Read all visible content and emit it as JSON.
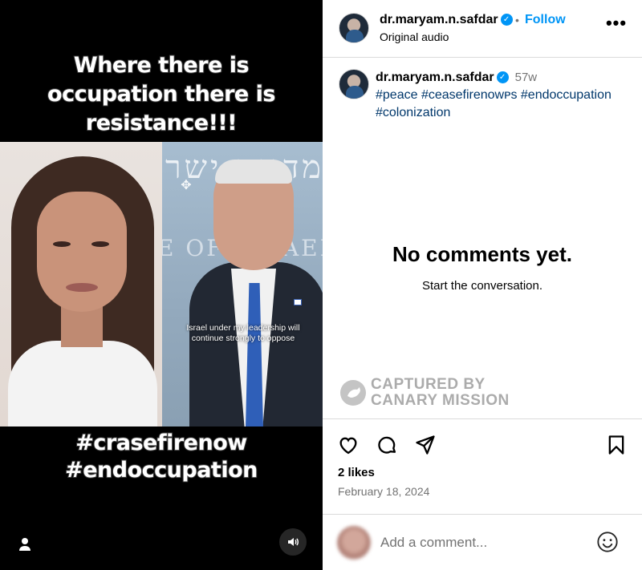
{
  "media": {
    "caption_top": [
      "Where there is",
      "occupation there is",
      "resistance!!!"
    ],
    "caption_bottom": [
      "#crasefirenow",
      "#endoccupation"
    ],
    "video_subtitle": "Israel under my leadership will continue strongly to oppose",
    "background_text_line1": "מדינת ישר",
    "background_text_line2": "E OF ISRAEL"
  },
  "header": {
    "username": "dr.maryam.n.safdar",
    "separator": "•",
    "follow_label": "Follow",
    "audio": "Original audio",
    "more_label": "•••"
  },
  "caption": {
    "username": "dr.maryam.n.safdar",
    "time": "57w",
    "hashtags": "#peace #ceasefirenowᴘs #endoccupation #colonization"
  },
  "comments_empty": {
    "title": "No comments yet.",
    "subtitle": "Start the conversation."
  },
  "watermark": {
    "line1": "CAPTURED BY",
    "line2": "CANARY MISSION"
  },
  "engagement": {
    "likes": "2 likes",
    "date": "February 18, 2024"
  },
  "comment_box": {
    "placeholder": "Add a comment..."
  },
  "icons": {
    "like": "heart-icon",
    "comment": "comment-bubble-icon",
    "share": "paper-plane-icon",
    "save": "bookmark-icon",
    "emoji": "smiley-icon",
    "sound": "speaker-icon",
    "tagged_user": "user-icon",
    "verified": "verified-badge-icon"
  },
  "colors": {
    "link_blue": "#0095f6",
    "hashtag_blue": "#00376b",
    "muted_text": "#737373",
    "divider": "#dbdbdb",
    "media_bg": "#000000"
  }
}
